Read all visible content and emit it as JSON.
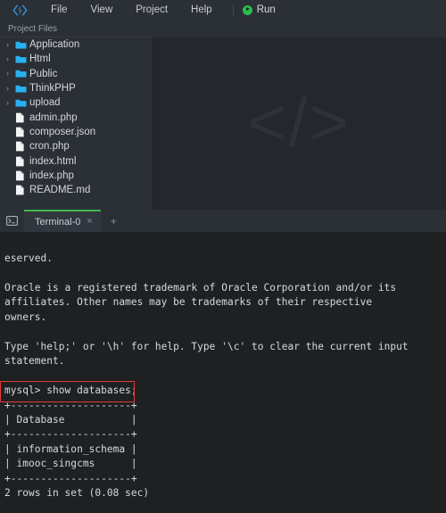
{
  "menubar": {
    "logo_icon": "bolt-logo-icon",
    "items": [
      {
        "label": "File"
      },
      {
        "label": "View"
      },
      {
        "label": "Project"
      },
      {
        "label": "Help"
      }
    ],
    "run": {
      "label": "Run",
      "icon": "play-circle-icon",
      "color": "#25c04a"
    }
  },
  "sidebar": {
    "header": "Project Files",
    "folder_color": "#29b0f0",
    "items": [
      {
        "name": "Application",
        "type": "folder",
        "expanded": false
      },
      {
        "name": "Html",
        "type": "folder",
        "expanded": false
      },
      {
        "name": "Public",
        "type": "folder",
        "expanded": false
      },
      {
        "name": "ThinkPHP",
        "type": "folder",
        "expanded": false
      },
      {
        "name": "upload",
        "type": "folder",
        "expanded": false
      },
      {
        "name": "admin.php",
        "type": "file"
      },
      {
        "name": "composer.json",
        "type": "file"
      },
      {
        "name": "cron.php",
        "type": "file"
      },
      {
        "name": "index.html",
        "type": "file"
      },
      {
        "name": "index.php",
        "type": "file"
      },
      {
        "name": "README.md",
        "type": "file"
      }
    ]
  },
  "editor": {
    "watermark": "</>"
  },
  "terminal_tabs": {
    "toolbar_icon": "terminal-icon",
    "tabs": [
      {
        "label": "Terminal-0",
        "active": true,
        "close_icon": "×"
      }
    ],
    "add_tab_icon": "+",
    "active_accent": "#3fb950"
  },
  "terminal": {
    "output": "eserved.\n\nOracle is a registered trademark of Oracle Corporation and/or its\naffiliates. Other names may be trademarks of their respective\nowners.\n\nType 'help;' or '\\h' for help. Type '\\c' to clear the current input\nstatement.\n\nmysql> show databases;\n+--------------------+\n| Database           |\n+--------------------+\n| information_schema |\n| imooc_singcms      |\n+--------------------+\n2 rows in set (0.08 sec)",
    "annotation": {
      "type": "rectangle",
      "color": "#e23b3b",
      "targets_line": "mysql> show databases;"
    }
  }
}
